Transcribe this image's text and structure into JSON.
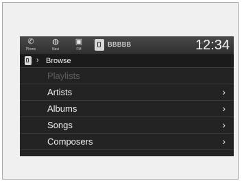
{
  "statusbar": {
    "buttons": [
      {
        "label": "Phone",
        "icon": "phone-icon",
        "glyph": "✆"
      },
      {
        "label": "Navi",
        "icon": "navi-icon",
        "glyph": "◍"
      },
      {
        "label": "FM",
        "icon": "fm-icon",
        "glyph": "▣"
      }
    ],
    "source_name": "BBBBB",
    "clock": "12:34"
  },
  "breadcrumb": {
    "title": "Browse"
  },
  "list": {
    "items": [
      {
        "label": "Playlists",
        "enabled": false
      },
      {
        "label": "Artists",
        "enabled": true
      },
      {
        "label": "Albums",
        "enabled": true
      },
      {
        "label": "Songs",
        "enabled": true
      },
      {
        "label": "Composers",
        "enabled": true
      }
    ]
  }
}
